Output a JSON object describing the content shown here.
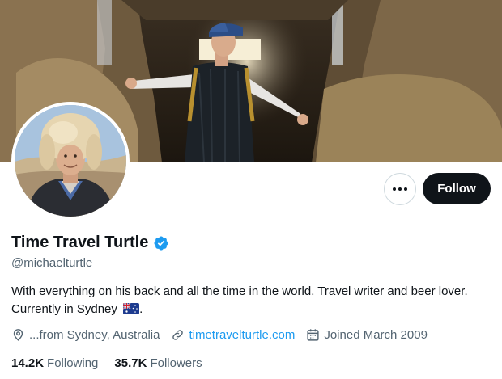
{
  "profile": {
    "display_name": "Time Travel Turtle",
    "handle": "@michaelturtle",
    "bio_line1": "With everything on his back and all the time in the world. Travel writer and beer lover.",
    "bio_line2": "Currently in Sydney",
    "location": "...from Sydney, Australia",
    "website": "timetravelturtle.com",
    "joined": "Joined March 2009"
  },
  "stats": {
    "following_count": "14.2K",
    "following_label": "Following",
    "followers_count": "35.7K",
    "followers_label": "Followers"
  },
  "actions": {
    "follow_label": "Follow",
    "more_icon": "more-horizontal-icon"
  },
  "icons": {
    "verified": "verified-badge-icon",
    "location": "location-pin-icon",
    "link": "link-icon",
    "calendar": "calendar-icon",
    "flag": "australia-flag-icon"
  },
  "colors": {
    "accent": "#1d9bf0",
    "text_primary": "#0f1419",
    "text_secondary": "#536471",
    "follow_bg": "#0f1419"
  }
}
